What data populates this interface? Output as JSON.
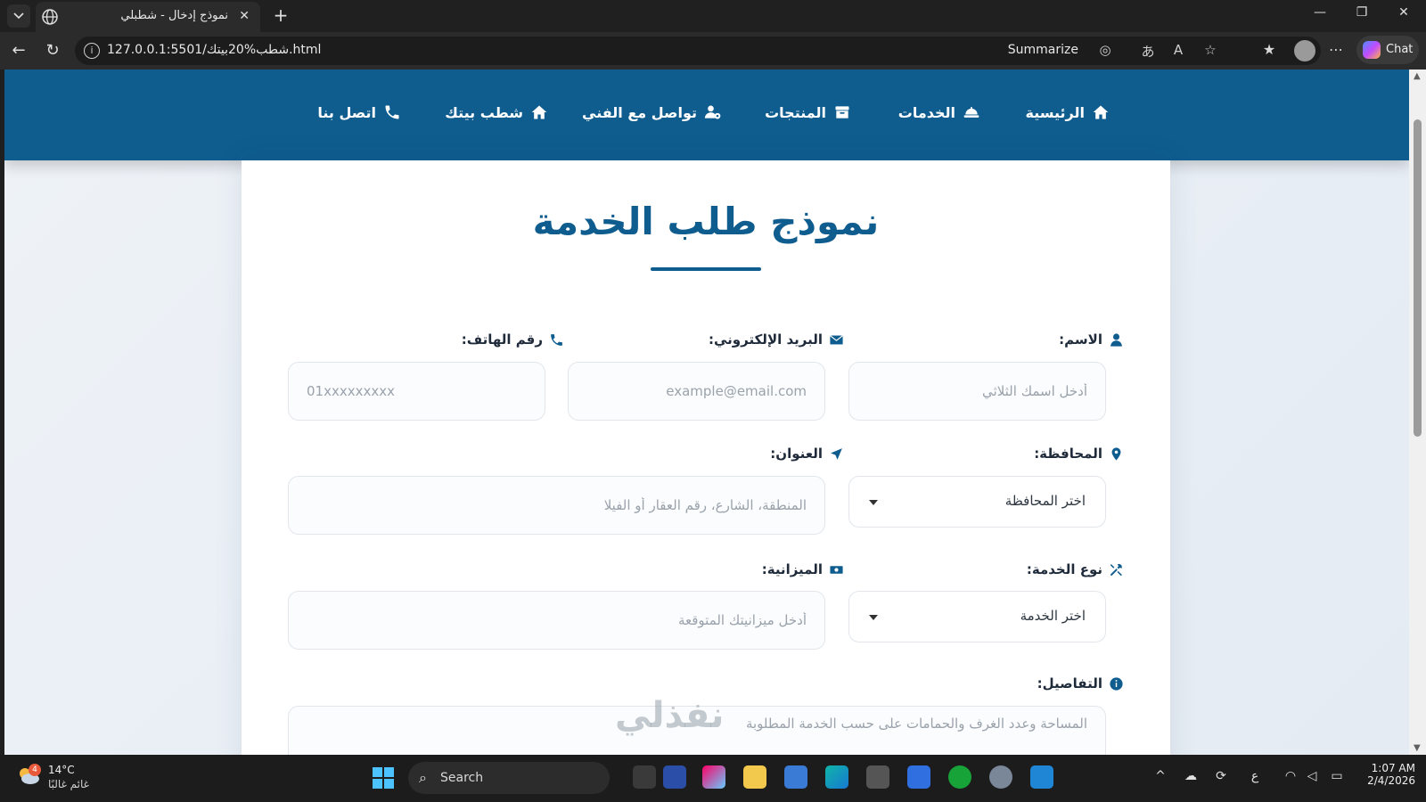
{
  "browser": {
    "tab_title": "نموذج إدخال - شطبلي",
    "url": "127.0.0.1:5501/شطب%20بيتك.html",
    "summarize_label": "Summarize",
    "chat_label": "Chat",
    "new_tab_label": "+",
    "close_tab_label": "✕"
  },
  "site_nav": {
    "items": [
      {
        "label": "الرئيسية",
        "icon": "home-icon"
      },
      {
        "label": "الخدمات",
        "icon": "service-bell-icon"
      },
      {
        "label": "المنتجات",
        "icon": "box-icon"
      },
      {
        "label": "تواصل مع الفني",
        "icon": "users-cog-icon"
      },
      {
        "label": "شطب بيتك",
        "icon": "home-icon"
      },
      {
        "label": "اتصل بنا",
        "icon": "phone-icon"
      }
    ]
  },
  "form": {
    "title": "نموذج طلب الخدمة",
    "fields": {
      "name": {
        "label": "الاسم:",
        "placeholder": "أدخل اسمك الثلاثي"
      },
      "email": {
        "label": "البريد الإلكتروني:",
        "placeholder": "example@email.com"
      },
      "phone": {
        "label": "رقم الهاتف:",
        "placeholder": "01xxxxxxxxx"
      },
      "governorate": {
        "label": "المحافظة:",
        "selected": "اختر المحافظة"
      },
      "address": {
        "label": "العنوان:",
        "placeholder": "المنطقة، الشارع، رقم العقار أو الفيلا"
      },
      "service_type": {
        "label": "نوع الخدمة:",
        "selected": "اختر الخدمة"
      },
      "budget": {
        "label": "الميزانية:",
        "placeholder": "أدخل ميزانيتك المتوقعة"
      },
      "details": {
        "label": "التفاصيل:",
        "placeholder": "المساحة وعدد الغرف والحمامات على حسب الخدمة المطلوبة"
      }
    }
  },
  "watermark": "نفذلي",
  "taskbar": {
    "temperature": "14°C",
    "weather_desc": "غائم غالبًا",
    "weather_badge": "4",
    "search_label": "Search",
    "time": "1:07 AM",
    "date": "2/4/2026"
  }
}
